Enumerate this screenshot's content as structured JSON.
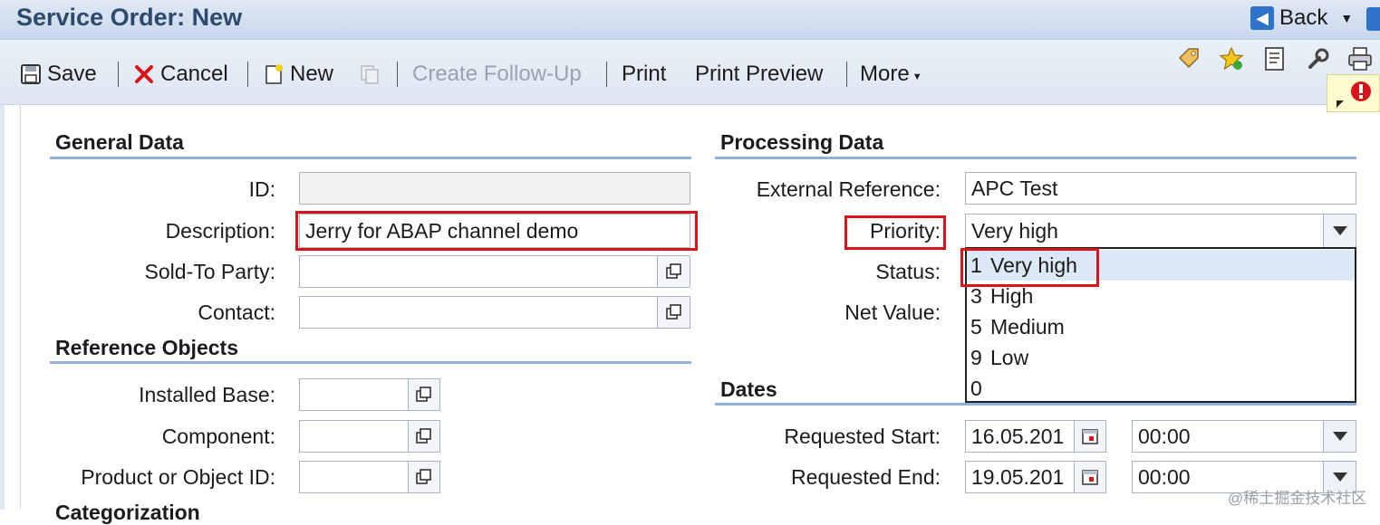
{
  "header": {
    "title": "Service Order: New",
    "back_label": "Back"
  },
  "toolbar": {
    "save": "Save",
    "cancel": "Cancel",
    "new": "New",
    "create_follow_up": "Create Follow-Up",
    "print": "Print",
    "print_preview": "Print Preview",
    "more": "More"
  },
  "general_data": {
    "title": "General Data",
    "id_label": "ID:",
    "id_value": "",
    "description_label": "Description:",
    "description_value": "Jerry for ABAP channel demo",
    "sold_to_label": "Sold-To Party:",
    "sold_to_value": "",
    "contact_label": "Contact:",
    "contact_value": ""
  },
  "reference_objects": {
    "title": "Reference Objects",
    "installed_base_label": "Installed Base:",
    "component_label": "Component:",
    "product_label": "Product or Object ID:"
  },
  "categorization": {
    "title": "Categorization"
  },
  "processing_data": {
    "title": "Processing Data",
    "external_ref_label": "External Reference:",
    "external_ref_value": "APC Test",
    "priority_label": "Priority:",
    "priority_value": "Very high",
    "status_label": "Status:",
    "net_value_label": "Net Value:"
  },
  "priority_options": [
    {
      "key": "1",
      "text": "Very high",
      "selected": true
    },
    {
      "key": "3",
      "text": "High",
      "selected": false
    },
    {
      "key": "5",
      "text": "Medium",
      "selected": false
    },
    {
      "key": "9",
      "text": "Low",
      "selected": false
    },
    {
      "key": "0",
      "text": "",
      "selected": false
    }
  ],
  "dates": {
    "title": "Dates",
    "requested_start_label": "Requested Start:",
    "requested_start_date": "16.05.201",
    "requested_start_time": "00:00",
    "requested_end_label": "Requested End:",
    "requested_end_date": "19.05.201",
    "requested_end_time": "00:00"
  },
  "watermark": "@稀土掘金技术社区",
  "colors": {
    "accent": "#2f73c9",
    "highlight_box": "#d7141a",
    "section_line": "#8fb0d8",
    "selected_row": "#dbe8f5"
  }
}
